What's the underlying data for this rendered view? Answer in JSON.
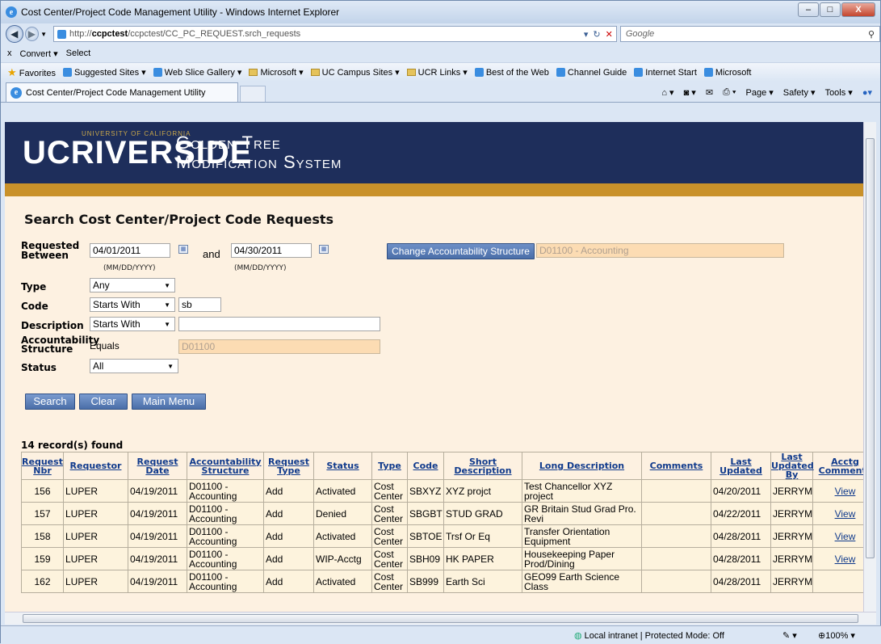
{
  "window": {
    "title": "Cost Center/Project Code Management Utility - Windows Internet Explorer",
    "min": "–",
    "max": "□",
    "close": "X"
  },
  "address": {
    "prefix": "http://",
    "host": "ccpctest",
    "path": "/ccpctest/CC_PC_REQUEST.srch_requests",
    "search_placeholder": "Google"
  },
  "command": {
    "close": "x",
    "convert": "Convert",
    "select": "Select"
  },
  "favorites": {
    "label": "Favorites",
    "items": [
      "Suggested Sites ▾",
      "Web Slice Gallery ▾",
      "Microsoft ▾",
      "UC Campus Sites ▾",
      "UCR Links ▾",
      "Best of the Web",
      "Channel Guide",
      "Internet Start",
      "Microsoft"
    ]
  },
  "tab": {
    "label": "Cost Center/Project Code Management Utility"
  },
  "tools": {
    "page": "Page ▾",
    "safety": "Safety ▾",
    "tools": "Tools ▾"
  },
  "banner": {
    "uc": "UNIVERSITY OF CALIFORNIA",
    "logo": "UCRIVERSIDE",
    "line1": "Golden Tree",
    "line2": "Modification System"
  },
  "page": {
    "title": "Search Cost Center/Project Code Requests"
  },
  "form": {
    "requested_between": "Requested Between",
    "date_from": "04/01/2011",
    "and": "and",
    "date_to": "04/30/2011",
    "date_hint": "(MM/DD/YYYY)",
    "type_label": "Type",
    "type_value": "Any",
    "code_label": "Code",
    "code_op": "Starts With",
    "code_value": "sb",
    "desc_label": "Description",
    "desc_op": "Starts With",
    "desc_value": "",
    "acct_label": "Accountability Structure",
    "acct_op": "Equals",
    "acct_value": "D01100",
    "status_label": "Status",
    "status_value": "All",
    "change_btn": "Change Accountability Structure",
    "change_value": "D01100 - Accounting"
  },
  "buttons": {
    "search": "Search",
    "clear": "Clear",
    "main_menu": "Main Menu"
  },
  "results": {
    "count": "14 record(s) found",
    "headers": [
      "Request Nbr",
      "Requestor",
      "Request Date",
      "Accountability Structure",
      "Request Type",
      "Status",
      "Type",
      "Code",
      "Short Description",
      "Long Description",
      "Comments",
      "Last Updated",
      "Last Updated By",
      "Acctg Comments"
    ],
    "rows": [
      {
        "nbr": "156",
        "req": "LUPER",
        "date": "04/19/2011",
        "acct": "D01100 - Accounting",
        "rtype": "Add",
        "status": "Activated",
        "type": "Cost Center",
        "code": "SBXYZ",
        "short": "XYZ projct",
        "long": "Test Chancellor XYZ project",
        "comments": "",
        "upd": "04/20/2011",
        "by": "JERRYM",
        "view": "View"
      },
      {
        "nbr": "157",
        "req": "LUPER",
        "date": "04/19/2011",
        "acct": "D01100 - Accounting",
        "rtype": "Add",
        "status": "Denied",
        "type": "Cost Center",
        "code": "SBGBT",
        "short": "STUD GRAD",
        "long": "GR Britain Stud Grad Pro. Revi",
        "comments": "",
        "upd": "04/22/2011",
        "by": "JERRYM",
        "view": "View"
      },
      {
        "nbr": "158",
        "req": "LUPER",
        "date": "04/19/2011",
        "acct": "D01100 - Accounting",
        "rtype": "Add",
        "status": "Activated",
        "type": "Cost Center",
        "code": "SBTOE",
        "short": "Trsf Or Eq",
        "long": "Transfer Orientation Equipment",
        "comments": "",
        "upd": "04/28/2011",
        "by": "JERRYM",
        "view": "View"
      },
      {
        "nbr": "159",
        "req": "LUPER",
        "date": "04/19/2011",
        "acct": "D01100 - Accounting",
        "rtype": "Add",
        "status": "WIP-Acctg",
        "type": "Cost Center",
        "code": "SBH09",
        "short": "HK PAPER",
        "long": "Housekeeping Paper Prod/Dining",
        "comments": "",
        "upd": "04/28/2011",
        "by": "JERRYM",
        "view": "View"
      },
      {
        "nbr": "162",
        "req": "LUPER",
        "date": "04/19/2011",
        "acct": "D01100 - Accounting",
        "rtype": "Add",
        "status": "Activated",
        "type": "Cost Center",
        "code": "SB999",
        "short": "Earth Sci",
        "long": "GEO99 Earth Science Class",
        "comments": "",
        "upd": "04/28/2011",
        "by": "JERRYM",
        "view": ""
      }
    ]
  },
  "status": {
    "zone": "Local intranet | Protected Mode: Off",
    "zoom": "100%"
  }
}
